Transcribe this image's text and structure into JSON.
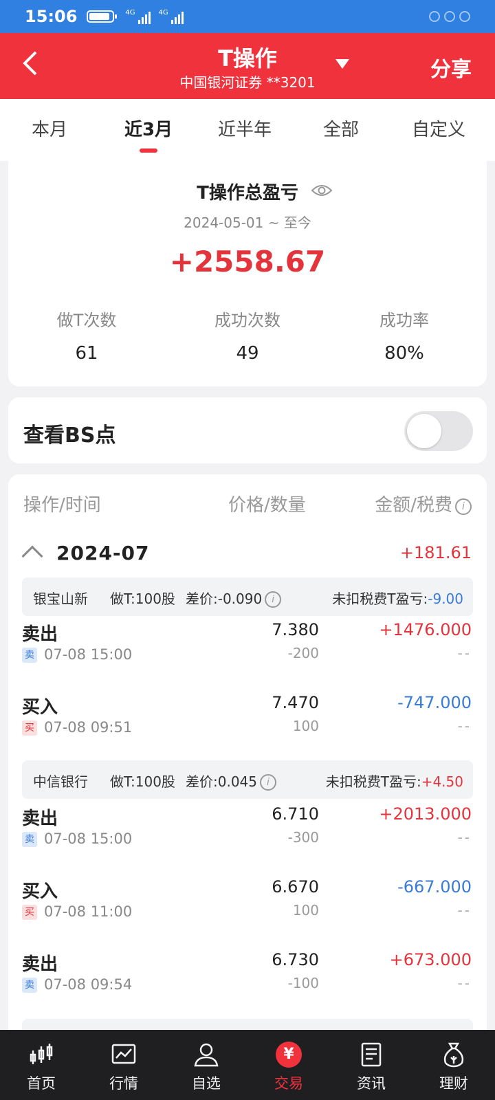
{
  "status": {
    "time": "15:06",
    "net1": "4G",
    "net2": "4G",
    "battery_level": 0.9
  },
  "header": {
    "title": "T操作",
    "account": "中国银河证券 **3201",
    "share": "分享"
  },
  "period_tabs": [
    "本月",
    "近3月",
    "近半年",
    "全部",
    "自定义"
  ],
  "active_period": "近3月",
  "summary": {
    "title": "T操作总盈亏",
    "date_range": "2024-05-01 ~ 至今",
    "total_pnl": "+2558.67",
    "stats": [
      {
        "label": "做T次数",
        "value": "61"
      },
      {
        "label": "成功次数",
        "value": "49"
      },
      {
        "label": "成功率",
        "value": "80%"
      }
    ]
  },
  "bs_toggle": {
    "label": "查看BS点",
    "on": false
  },
  "list": {
    "headers": {
      "op_time": "操作/时间",
      "price_qty": "价格/数量",
      "amount_fee": "金额/税费"
    },
    "month": {
      "label": "2024-07",
      "total": "+181.61"
    },
    "groups": [
      {
        "name": "银宝山新",
        "t_qty": "做T:100股",
        "diff": "差价:-0.090",
        "pnl_label": "未扣税费T盈亏:",
        "pnl": "-9.00",
        "trades": [
          {
            "action": "卖出",
            "badge": "卖",
            "time": "07-08 15:00",
            "price": "7.380",
            "qty": "-200",
            "amount": "+1476.000",
            "fee": "--"
          },
          {
            "action": "买入",
            "badge": "买",
            "time": "07-08 09:51",
            "price": "7.470",
            "qty": "100",
            "amount": "-747.000",
            "fee": "--"
          }
        ]
      },
      {
        "name": "中信银行",
        "t_qty": "做T:100股",
        "diff": "差价:0.045",
        "pnl_label": "未扣税费T盈亏:",
        "pnl": "+4.50",
        "trades": [
          {
            "action": "卖出",
            "badge": "卖",
            "time": "07-08 15:00",
            "price": "6.710",
            "qty": "-300",
            "amount": "+2013.000",
            "fee": "--"
          },
          {
            "action": "买入",
            "badge": "买",
            "time": "07-08 11:00",
            "price": "6.670",
            "qty": "100",
            "amount": "-667.000",
            "fee": "--"
          },
          {
            "action": "卖出",
            "badge": "卖",
            "time": "07-08 09:54",
            "price": "6.730",
            "qty": "-100",
            "amount": "+673.000",
            "fee": "--"
          }
        ]
      }
    ]
  },
  "tabbar": [
    {
      "label": "首页",
      "icon": "candlestick-icon"
    },
    {
      "label": "行情",
      "icon": "chart-icon"
    },
    {
      "label": "自选",
      "icon": "user-icon"
    },
    {
      "label": "交易",
      "icon": "yen-icon",
      "symbol": "¥"
    },
    {
      "label": "资讯",
      "icon": "document-icon"
    },
    {
      "label": "理财",
      "icon": "moneybag-icon"
    }
  ],
  "colors": {
    "brand_red": "#f0323d",
    "status_blue": "#2f80e0",
    "profit": "#e3343c",
    "loss": "#3a7bd5"
  }
}
